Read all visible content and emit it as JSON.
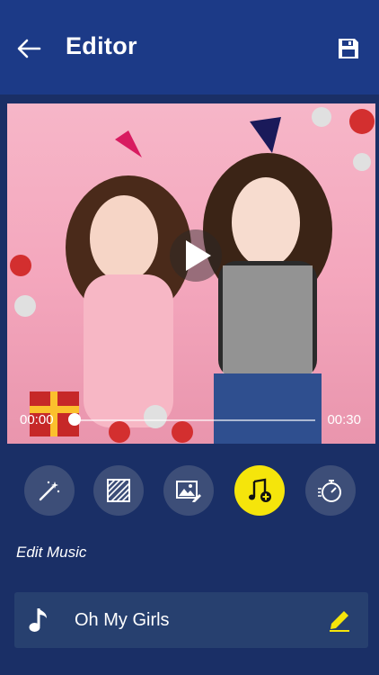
{
  "header": {
    "title": "Editor",
    "back_icon": "arrow-left-icon",
    "save_icon": "floppy-save-icon"
  },
  "player": {
    "time_start": "00:00",
    "time_end": "00:30",
    "progress": 0.0
  },
  "tools": [
    {
      "name": "magic-wand-icon",
      "active": false
    },
    {
      "name": "pattern-frame-icon",
      "active": false
    },
    {
      "name": "image-edit-icon",
      "active": false
    },
    {
      "name": "music-add-icon",
      "active": true
    },
    {
      "name": "timer-speed-icon",
      "active": false
    }
  ],
  "section": {
    "label": "Edit Music"
  },
  "music": {
    "track_name": "Oh My Girls"
  },
  "colors": {
    "header_bg": "#1c3a87",
    "page_bg": "#1a2f66",
    "accent": "#f5e50b",
    "tool_bg": "#3d4e78"
  }
}
